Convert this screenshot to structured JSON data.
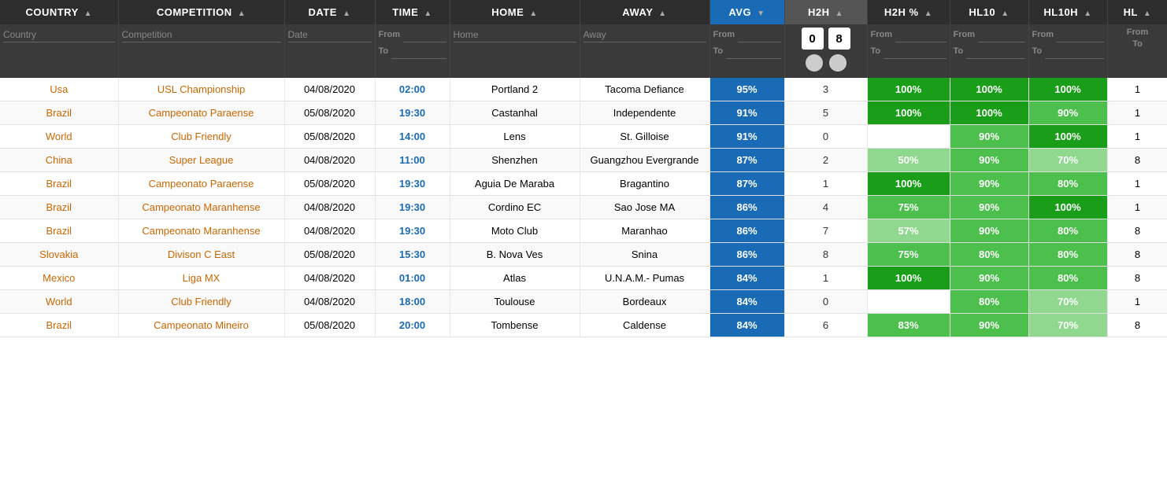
{
  "columns": [
    {
      "key": "country",
      "label": "COUNTRY",
      "class": "col-country"
    },
    {
      "key": "competition",
      "label": "COMPETITION",
      "class": "col-comp"
    },
    {
      "key": "date",
      "label": "DATE",
      "class": "col-date"
    },
    {
      "key": "time",
      "label": "TIME",
      "class": "col-time"
    },
    {
      "key": "home",
      "label": "HOME",
      "class": "col-home"
    },
    {
      "key": "away",
      "label": "AWAY",
      "class": "col-away"
    },
    {
      "key": "avg",
      "label": "AVG",
      "class": "col-avg"
    },
    {
      "key": "h2h",
      "label": "H2H",
      "class": "col-h2h"
    },
    {
      "key": "h2hp",
      "label": "H2H %",
      "class": "col-h2hp"
    },
    {
      "key": "hl10",
      "label": "HL10",
      "class": "col-hl10"
    },
    {
      "key": "hl10h",
      "label": "HL10H",
      "class": "col-hl10h"
    },
    {
      "key": "hl",
      "label": "HL",
      "class": "col-hl"
    }
  ],
  "filter": {
    "from_label": "From",
    "to_label": "To",
    "country_placeholder": "Country",
    "competition_placeholder": "Competition",
    "date_placeholder": "Date",
    "home_placeholder": "Home",
    "away_placeholder": "Away",
    "h2h_min": "0",
    "h2h_max": "8",
    "avg_from": "From",
    "avg_to": "To"
  },
  "rows": [
    {
      "country": "Usa",
      "competition": "USL Championship",
      "date": "04/08/2020",
      "time": "02:00",
      "home": "Portland 2",
      "away": "Tacoma Defiance",
      "avg": "95%",
      "h2h": "3",
      "h2hp": "100%",
      "h2hp_level": "dark",
      "hl10": "100%",
      "hl10_level": "dark",
      "hl10h": "100%",
      "hl10h_level": "dark",
      "hl": "1"
    },
    {
      "country": "Brazil",
      "competition": "Campeonato Paraense",
      "date": "05/08/2020",
      "time": "19:30",
      "home": "Castanhal",
      "away": "Independente",
      "avg": "91%",
      "h2h": "5",
      "h2hp": "100%",
      "h2hp_level": "dark",
      "hl10": "100%",
      "hl10_level": "dark",
      "hl10h": "90%",
      "hl10h_level": "green",
      "hl": "1"
    },
    {
      "country": "World",
      "competition": "Club Friendly",
      "date": "05/08/2020",
      "time": "14:00",
      "home": "Lens",
      "away": "St. Gilloise",
      "avg": "91%",
      "h2h": "0",
      "h2hp": "",
      "h2hp_level": "empty",
      "hl10": "90%",
      "hl10_level": "green",
      "hl10h": "100%",
      "hl10h_level": "dark",
      "hl": "1"
    },
    {
      "country": "China",
      "competition": "Super League",
      "date": "04/08/2020",
      "time": "11:00",
      "home": "Shenzhen",
      "away": "Guangzhou Evergrande",
      "avg": "87%",
      "h2h": "2",
      "h2hp": "50%",
      "h2hp_level": "light",
      "hl10": "90%",
      "hl10_level": "green",
      "hl10h": "70%",
      "hl10h_level": "light",
      "hl": "8"
    },
    {
      "country": "Brazil",
      "competition": "Campeonato Paraense",
      "date": "05/08/2020",
      "time": "19:30",
      "home": "Aguia De Maraba",
      "away": "Bragantino",
      "avg": "87%",
      "h2h": "1",
      "h2hp": "100%",
      "h2hp_level": "dark",
      "hl10": "90%",
      "hl10_level": "green",
      "hl10h": "80%",
      "hl10h_level": "green",
      "hl": "1"
    },
    {
      "country": "Brazil",
      "competition": "Campeonato Maranhense",
      "date": "04/08/2020",
      "time": "19:30",
      "home": "Cordino EC",
      "away": "Sao Jose MA",
      "avg": "86%",
      "h2h": "4",
      "h2hp": "75%",
      "h2hp_level": "green",
      "hl10": "90%",
      "hl10_level": "green",
      "hl10h": "100%",
      "hl10h_level": "dark",
      "hl": "1"
    },
    {
      "country": "Brazil",
      "competition": "Campeonato Maranhense",
      "date": "04/08/2020",
      "time": "19:30",
      "home": "Moto Club",
      "away": "Maranhao",
      "avg": "86%",
      "h2h": "7",
      "h2hp": "57%",
      "h2hp_level": "light",
      "hl10": "90%",
      "hl10_level": "green",
      "hl10h": "80%",
      "hl10h_level": "green",
      "hl": "8"
    },
    {
      "country": "Slovakia",
      "competition": "Divison C East",
      "date": "05/08/2020",
      "time": "15:30",
      "home": "B. Nova Ves",
      "away": "Snina",
      "avg": "86%",
      "h2h": "8",
      "h2hp": "75%",
      "h2hp_level": "green",
      "hl10": "80%",
      "hl10_level": "green",
      "hl10h": "80%",
      "hl10h_level": "green",
      "hl": "8"
    },
    {
      "country": "Mexico",
      "competition": "Liga MX",
      "date": "04/08/2020",
      "time": "01:00",
      "home": "Atlas",
      "away": "U.N.A.M.- Pumas",
      "avg": "84%",
      "h2h": "1",
      "h2hp": "100%",
      "h2hp_level": "dark",
      "hl10": "90%",
      "hl10_level": "green",
      "hl10h": "80%",
      "hl10h_level": "green",
      "hl": "8"
    },
    {
      "country": "World",
      "competition": "Club Friendly",
      "date": "04/08/2020",
      "time": "18:00",
      "home": "Toulouse",
      "away": "Bordeaux",
      "avg": "84%",
      "h2h": "0",
      "h2hp": "",
      "h2hp_level": "empty",
      "hl10": "80%",
      "hl10_level": "green",
      "hl10h": "70%",
      "hl10h_level": "light",
      "hl": "1"
    },
    {
      "country": "Brazil",
      "competition": "Campeonato Mineiro",
      "date": "05/08/2020",
      "time": "20:00",
      "home": "Tombense",
      "away": "Caldense",
      "avg": "84%",
      "h2h": "6",
      "h2hp": "83%",
      "h2hp_level": "green",
      "hl10": "90%",
      "hl10_level": "green",
      "hl10h": "70%",
      "hl10h_level": "light",
      "hl": "8"
    }
  ]
}
